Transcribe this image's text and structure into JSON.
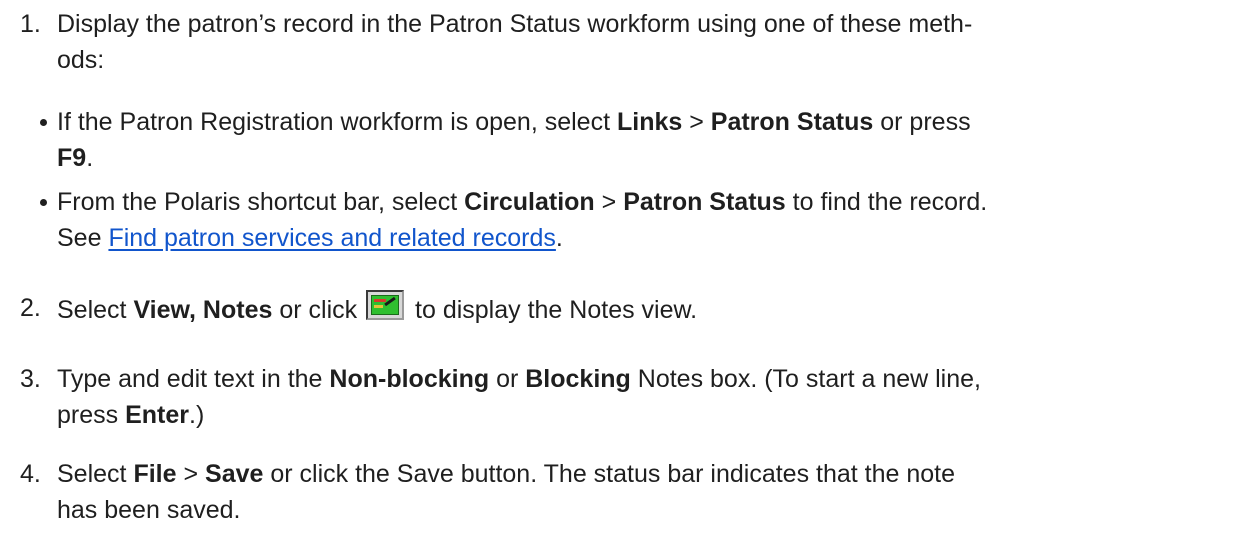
{
  "steps": {
    "s1": {
      "num": "1.",
      "text": "Display the patron’s record in the Patron Status workform using one of these meth-",
      "text2": "ods:"
    },
    "b1": {
      "pre": "If the Patron Registration workform is open, select ",
      "b_links": "Links",
      "sep1": " > ",
      "b_patron_status": "Patron Status",
      "mid": " or press",
      "b_f9": "F9",
      "end": "."
    },
    "b2": {
      "pre": "From the Polaris shortcut bar, select ",
      "b_circulation": "Circulation",
      "sep1": " > ",
      "b_patron_status": "Patron Status",
      "post": " to find the record.",
      "see": "See ",
      "link": "Find patron services and related records",
      "end": "."
    },
    "s2": {
      "num": "2.",
      "pre": "Select ",
      "b_view_notes": "View, Notes",
      "mid": " or click ",
      "post": " to display the Notes view."
    },
    "s3": {
      "num": "3.",
      "pre": "Type and edit text in the ",
      "b_nonblocking": "Non-blocking",
      "or": " or ",
      "b_blocking": "Blocking",
      "post": " Notes box. (To start a new line,",
      "line2_pre": "press ",
      "b_enter": "Enter",
      "line2_post": ".)"
    },
    "s4": {
      "num": "4.",
      "pre": "Select ",
      "b_file": "File",
      "sep1": " > ",
      "b_save": "Save",
      "post": " or click the Save button. The status bar indicates that the note",
      "line2": "has been saved."
    }
  },
  "icons": {
    "notes_view": "notes-view-icon"
  }
}
